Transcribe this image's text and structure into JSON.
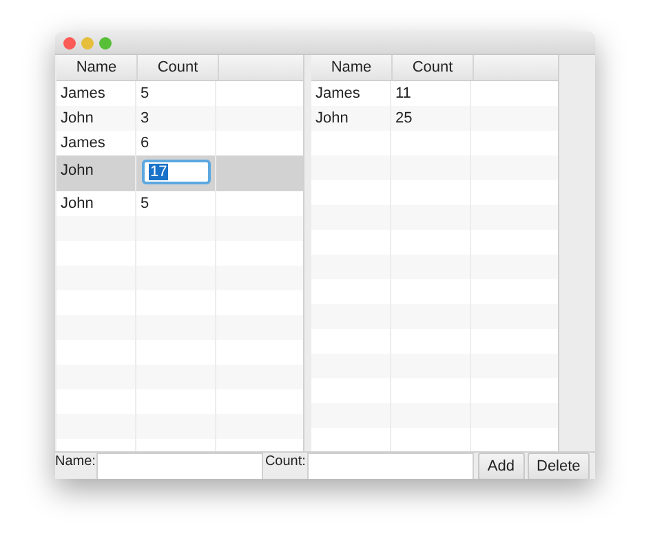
{
  "left_table": {
    "columns": [
      "Name",
      "Count"
    ],
    "rows": [
      {
        "name": "James",
        "count": "5",
        "selected": false
      },
      {
        "name": "John",
        "count": "3",
        "selected": false
      },
      {
        "name": "James",
        "count": "6",
        "selected": false
      },
      {
        "name": "John",
        "count": "17",
        "selected": true
      },
      {
        "name": "John",
        "count": "5",
        "selected": false
      }
    ]
  },
  "right_table": {
    "columns": [
      "Name",
      "Count"
    ],
    "rows": [
      {
        "name": "James",
        "count": "11",
        "selected": false
      },
      {
        "name": "John",
        "count": "25",
        "selected": false
      }
    ]
  },
  "form": {
    "name_label": "Name:",
    "count_label": "Count:"
  },
  "buttons": [
    "Add",
    "Delete"
  ]
}
